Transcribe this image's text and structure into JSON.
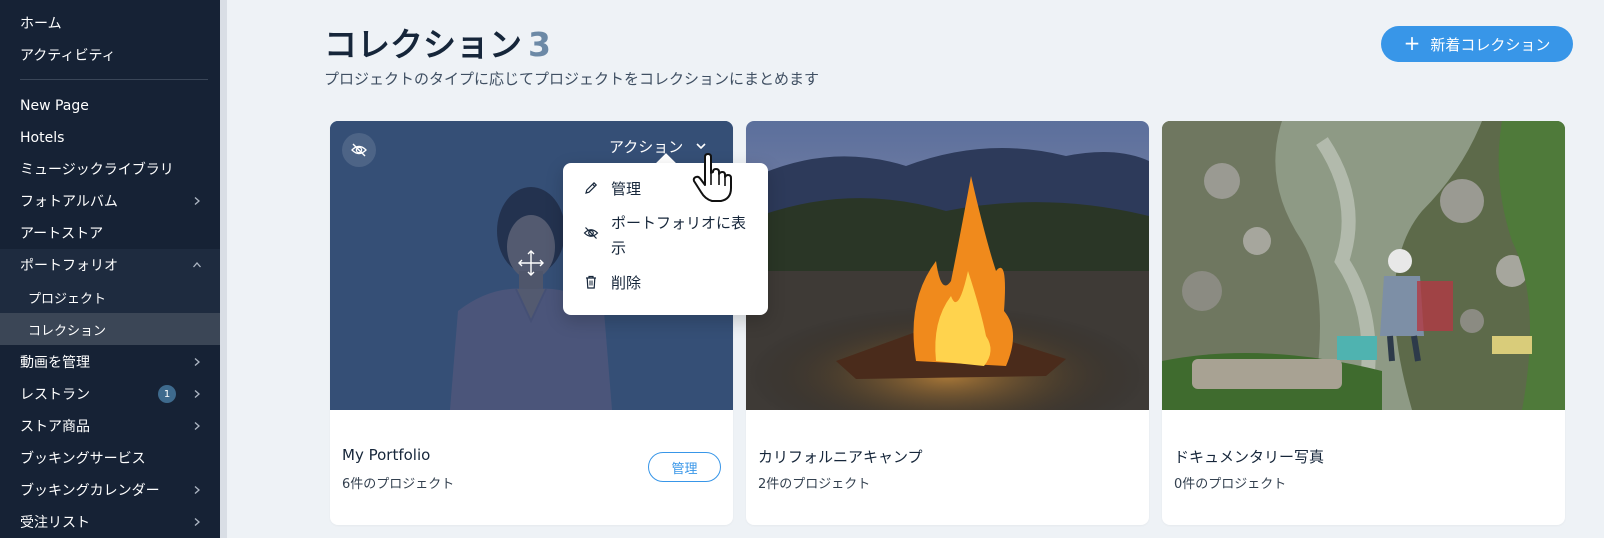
{
  "sidebar": {
    "items": [
      {
        "label": "ホーム"
      },
      {
        "label": "アクティビティ"
      },
      {
        "label": "New Page"
      },
      {
        "label": "Hotels"
      },
      {
        "label": "ミュージックライブラリ"
      },
      {
        "label": "フォトアルバム"
      },
      {
        "label": "アートストア"
      },
      {
        "label": "ポートフォリオ"
      },
      {
        "label": "プロジェクト"
      },
      {
        "label": "コレクション"
      },
      {
        "label": "動画を管理"
      },
      {
        "label": "レストラン",
        "badge": "1"
      },
      {
        "label": "ストア商品"
      },
      {
        "label": "ブッキングサービス"
      },
      {
        "label": "ブッキングカレンダー"
      },
      {
        "label": "受注リスト"
      }
    ]
  },
  "header": {
    "title": "コレクション",
    "count": "3",
    "subtitle": "プロジェクトのタイプに応じてプロジェクトをコレクションにまとめます",
    "new_button": "新着コレクション"
  },
  "cards": [
    {
      "title": "My Portfolio",
      "count": "6件のプロジェクト",
      "manage_label": "管理",
      "actions_label": "アクション"
    },
    {
      "title": "カリフォルニアキャンプ",
      "count": "2件のプロジェクト"
    },
    {
      "title": "ドキュメンタリー写真",
      "count": "0件のプロジェクト"
    }
  ],
  "action_menu": {
    "items": [
      {
        "label": "管理",
        "icon": "pencil-icon"
      },
      {
        "label": "ポートフォリオに表示",
        "icon": "eye-off-icon"
      },
      {
        "label": "削除",
        "icon": "trash-icon"
      }
    ]
  },
  "colors": {
    "accent": "#3896e8",
    "sidebar_bg": "#162235",
    "title": "#16263a",
    "count": "#6c89a6"
  }
}
